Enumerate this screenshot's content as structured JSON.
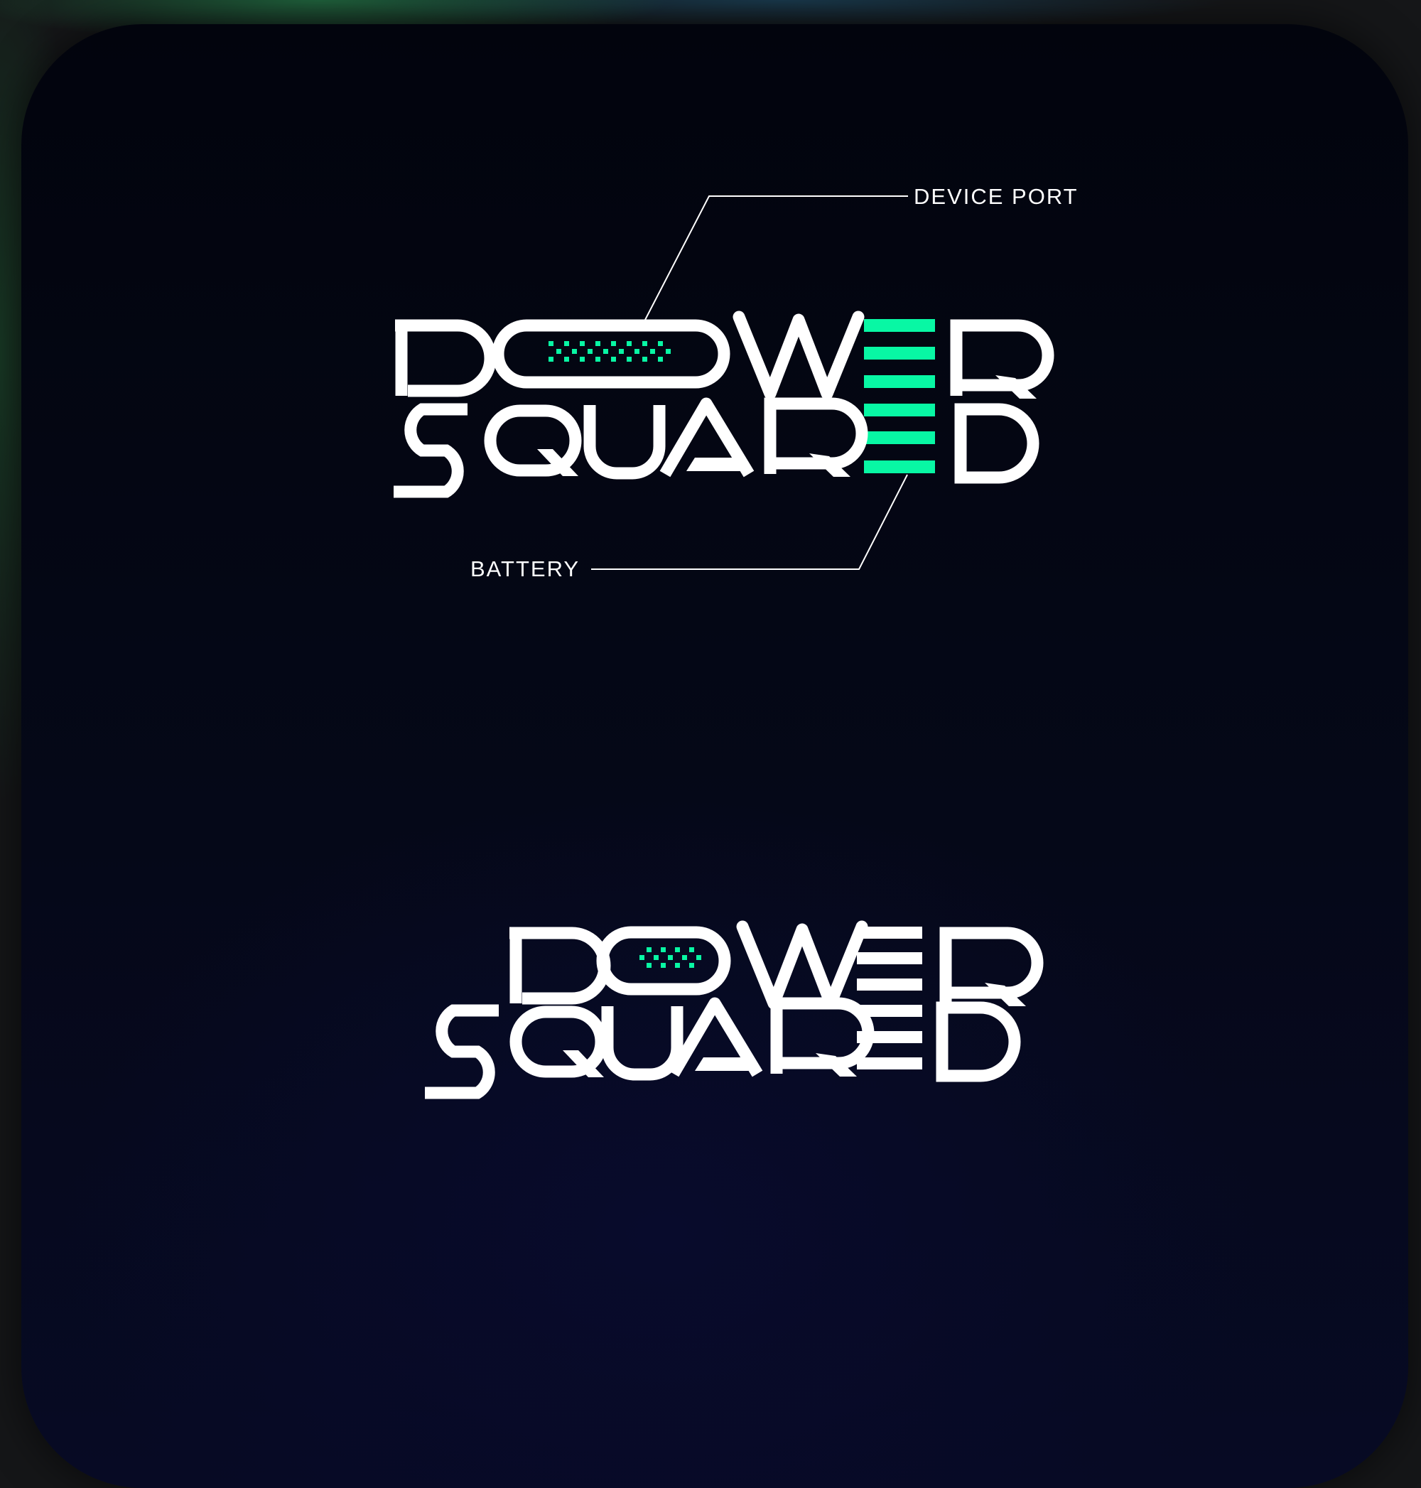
{
  "brand": {
    "word1": "POWER",
    "word2": "SQUARED",
    "logo_mark_alt": "POWER SQUARED"
  },
  "callouts": {
    "top": "DEVICE PORT",
    "bottom": "BATTERY"
  },
  "colors": {
    "background": "#03050f",
    "letters": "#ffffff",
    "accent": "#08f7a4"
  }
}
